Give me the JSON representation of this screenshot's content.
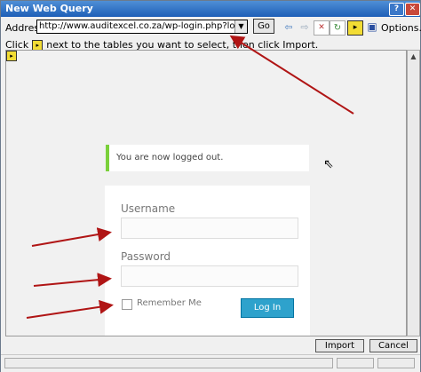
{
  "window": {
    "title": "New Web Query"
  },
  "address": {
    "label": "Address:",
    "value": "http://www.auditexcel.co.za/wp-login.php?loggedout=true",
    "go_label": "Go"
  },
  "toolbar": {
    "options_label": "Options..."
  },
  "instructions": {
    "before": "Click",
    "after": "next to the tables you want to select, then click Import."
  },
  "page": {
    "notice": "You are now logged out.",
    "username_label": "Username",
    "password_label": "Password",
    "remember_label": "Remember Me",
    "login_label": "Log In"
  },
  "buttons": {
    "import_label": "Import",
    "cancel_label": "Cancel"
  },
  "colors": {
    "annotation_arrow": "#b01515",
    "login_button": "#2ea2cc",
    "notice_border": "#7ad03a"
  },
  "icons": [
    "help-icon",
    "close-icon",
    "back-icon",
    "forward-icon",
    "stop-icon",
    "refresh-icon",
    "hide-icons-icon",
    "save-query-icon",
    "select-table-arrow-icon",
    "mouse-cursor-icon"
  ]
}
